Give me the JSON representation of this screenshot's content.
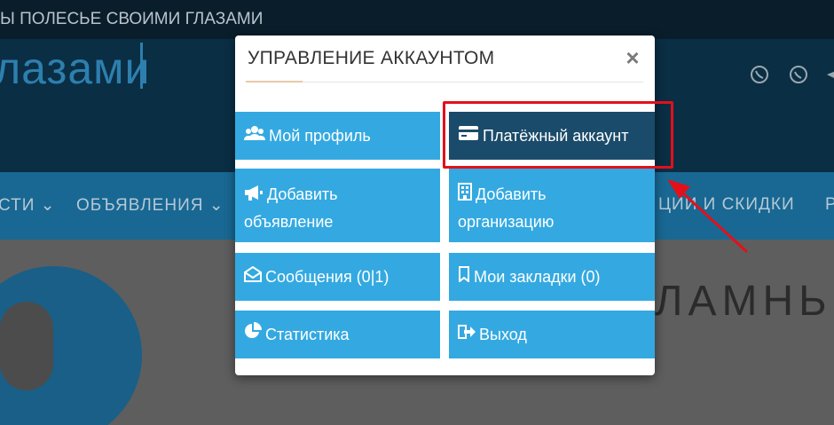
{
  "background": {
    "topbar_text": "Ы ПОЛЕСЬЕ СВОИМИ ГЛАЗАМИ",
    "logo_text": "лазами",
    "nav": [
      {
        "label": "СТИ"
      },
      {
        "label": "ОБЪЯВЛЕНИЯ"
      },
      {
        "label": "ЦИИ И СКИДКИ"
      },
      {
        "label": "Р"
      }
    ],
    "hero_text": "ЛАМНЬ"
  },
  "modal": {
    "title": "УПРАВЛЕНИЕ АККАУНТОМ",
    "close_label": "×",
    "tiles": [
      {
        "id": "profile",
        "icon": "users-icon",
        "label": "Мой профиль",
        "active": false
      },
      {
        "id": "payment",
        "icon": "credit-card-icon",
        "label": "Платёжный аккаунт",
        "active": true
      },
      {
        "id": "add-ad",
        "icon": "bullhorn-icon",
        "label_line1": "Добавить",
        "label_line2": "объявление",
        "active": false
      },
      {
        "id": "add-org",
        "icon": "building-icon",
        "label_line1": "Добавить",
        "label_line2": "организацию",
        "active": false
      },
      {
        "id": "messages",
        "icon": "envelope-open-icon",
        "label": "Сообщения (0|1)",
        "active": false
      },
      {
        "id": "bookmarks",
        "icon": "bookmark-icon",
        "label": "Мои закладки (0)",
        "active": false
      },
      {
        "id": "stats",
        "icon": "pie-chart-icon",
        "label": "Статистика",
        "active": false
      },
      {
        "id": "logout",
        "icon": "sign-out-icon",
        "label": "Выход",
        "active": false
      }
    ]
  },
  "colors": {
    "tile": "#34a9e1",
    "tile_active": "#1b4b6b",
    "annotation": "#e3101a"
  }
}
